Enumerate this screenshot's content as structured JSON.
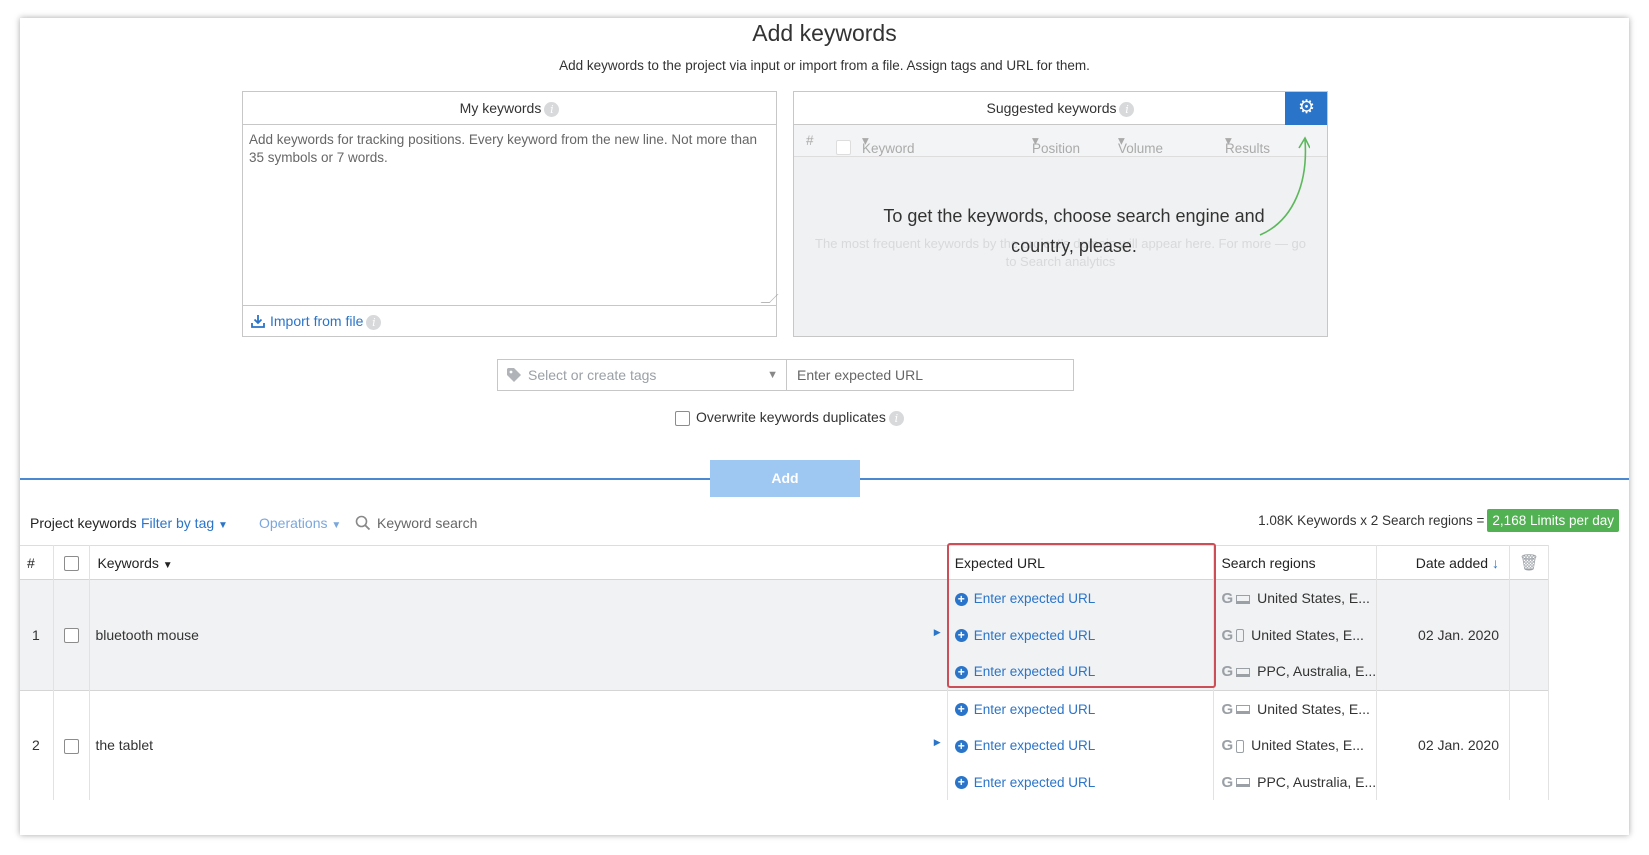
{
  "header": {
    "title": "Add keywords",
    "subtitle": "Add keywords to the project via input or import from a file. Assign tags and URL for them."
  },
  "my_keywords": {
    "title": "My keywords",
    "placeholder": "Add keywords for tracking positions. Every keyword from the new line. Not more than 35 symbols or 7 words.",
    "import_label": "Import from file"
  },
  "suggested": {
    "title": "Suggested keywords",
    "columns": [
      "#",
      "Keyword",
      "Position",
      "Volume",
      "Results"
    ],
    "faded_text": "The most frequent keywords by the project's domain will appear here. For more — go to Search analytics",
    "message": "To get the keywords, choose search engine and country, please."
  },
  "form": {
    "tags_placeholder": "Select or create tags",
    "url_placeholder": "Enter expected URL",
    "overwrite_label": "Overwrite keywords duplicates",
    "add_label": "Add"
  },
  "toolbar": {
    "project_keywords": "Project keywords",
    "filter_by_tag": "Filter by tag",
    "operations": "Operations",
    "search_placeholder": "Keyword search",
    "limits_text": "1.08K Keywords x 2 Search regions =",
    "limits_badge": "2,168 Limits per day"
  },
  "table": {
    "headers": {
      "num": "#",
      "keywords": "Keywords",
      "expected_url": "Expected URL",
      "search_regions": "Search regions",
      "date_added": "Date added"
    },
    "rows": [
      {
        "num": "1",
        "keyword": "bluetooth mouse",
        "urls": [
          "Enter expected URL",
          "Enter expected URL",
          "Enter expected URL"
        ],
        "regions": [
          "United States, E...",
          "United States, E...",
          "PPC, Australia, E..."
        ],
        "date": "02 Jan. 2020"
      },
      {
        "num": "2",
        "keyword": "the tablet",
        "urls": [
          "Enter expected URL",
          "Enter expected URL",
          "Enter expected URL"
        ],
        "regions": [
          "United States, E...",
          "United States, E...",
          "PPC, Australia, E..."
        ],
        "date": "02 Jan. 2020"
      }
    ]
  },
  "colors": {
    "accent": "#2a74c9",
    "limit_badge": "#52b152",
    "highlight": "#cc4f57"
  }
}
